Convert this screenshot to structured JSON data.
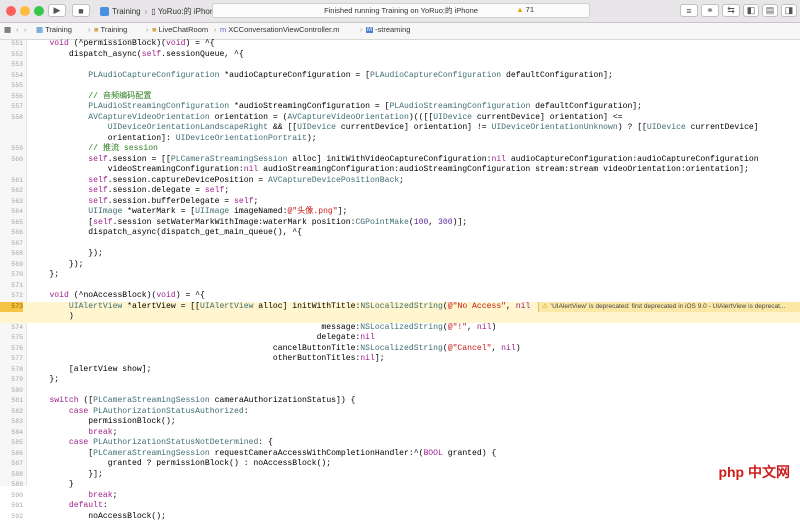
{
  "toolbar": {
    "scheme": "Training",
    "device": "YoRuo:的 iPhone",
    "status_text": "Finished running Training on YoRuo:的 iPhone",
    "warning_count": "71"
  },
  "pathbar": {
    "crumbs": [
      "Training",
      "Training",
      "LiveChatRoom",
      "XCConversationViewController.m",
      "-streaming"
    ]
  },
  "warning": {
    "message": "'UIAlertView' is deprecated: first deprecated in iOS 9.0 - UIAlertView is deprecat..."
  },
  "watermark": "php 中文网",
  "code_lines": [
    {
      "num": "551",
      "text": "    void (^permissionBlock)(void) = ^{"
    },
    {
      "num": "552",
      "text": "        dispatch_async(self.sessionQueue, ^{"
    },
    {
      "num": "553",
      "text": ""
    },
    {
      "num": "554",
      "text": "            PLAudioCaptureConfiguration *audioCaptureConfiguration = [PLAudioCaptureConfiguration defaultConfiguration];"
    },
    {
      "num": "555",
      "text": ""
    },
    {
      "num": "556",
      "text": "            // 音频编码配置"
    },
    {
      "num": "557",
      "text": "            PLAudioStreamingConfiguration *audioStreamingConfiguration = [PLAudioStreamingConfiguration defaultConfiguration];"
    },
    {
      "num": "558",
      "text": "            AVCaptureVideoOrientation orientation = (AVCaptureVideoOrientation)(([[UIDevice currentDevice] orientation] <="
    },
    {
      "num": "",
      "text": "                UIDeviceOrientationLandscapeRight && [[UIDevice currentDevice] orientation] != UIDeviceOrientationUnknown) ? [[UIDevice currentDevice]"
    },
    {
      "num": "",
      "text": "                orientation]: UIDeviceOrientationPortrait);"
    },
    {
      "num": "559",
      "text": "            // 推流 session"
    },
    {
      "num": "560",
      "text": "            self.session = [[PLCameraStreamingSession alloc] initWithVideoCaptureConfiguration:nil audioCaptureConfiguration:audioCaptureConfiguration"
    },
    {
      "num": "",
      "text": "                videoStreamingConfiguration:nil audioStreamingConfiguration:audioStreamingConfiguration stream:stream videoOrientation:orientation];"
    },
    {
      "num": "561",
      "text": "            self.session.captureDevicePosition = AVCaptureDevicePositionBack;"
    },
    {
      "num": "562",
      "text": "            self.session.delegate = self;"
    },
    {
      "num": "563",
      "text": "            self.session.bufferDelegate = self;"
    },
    {
      "num": "564",
      "text": "            UIImage *waterMark = [UIImage imageNamed:@\"头像.png\"];"
    },
    {
      "num": "565",
      "text": "            [self.session setWaterMarkWithImage:waterMark position:CGPointMake(100, 300)];"
    },
    {
      "num": "566",
      "text": "            dispatch_async(dispatch_get_main_queue(), ^{"
    },
    {
      "num": "567",
      "text": ""
    },
    {
      "num": "568",
      "text": "            });"
    },
    {
      "num": "569",
      "text": "        });"
    },
    {
      "num": "570",
      "text": "    };"
    },
    {
      "num": "571",
      "text": ""
    },
    {
      "num": "572",
      "text": "    void (^noAccessBlock)(void) = ^{"
    },
    {
      "num": "573",
      "text": "        UIAlertView *alertView = [[UIAlertView alloc] initWithTitle:NSLocalizedString(@\"No Access\", nil"
    },
    {
      "num": "",
      "text": "        )"
    },
    {
      "num": "574",
      "text": "                                                            message:NSLocalizedString(@\"!\", nil)"
    },
    {
      "num": "575",
      "text": "                                                           delegate:nil"
    },
    {
      "num": "576",
      "text": "                                                  cancelButtonTitle:NSLocalizedString(@\"Cancel\", nil)"
    },
    {
      "num": "577",
      "text": "                                                  otherButtonTitles:nil];"
    },
    {
      "num": "578",
      "text": "        [alertView show];"
    },
    {
      "num": "579",
      "text": "    };"
    },
    {
      "num": "580",
      "text": ""
    },
    {
      "num": "581",
      "text": "    switch ([PLCameraStreamingSession cameraAuthorizationStatus]) {"
    },
    {
      "num": "582",
      "text": "        case PLAuthorizationStatusAuthorized:"
    },
    {
      "num": "583",
      "text": "            permissionBlock();"
    },
    {
      "num": "584",
      "text": "            break;"
    },
    {
      "num": "585",
      "text": "        case PLAuthorizationStatusNotDetermined: {"
    },
    {
      "num": "586",
      "text": "            [PLCameraStreamingSession requestCameraAccessWithCompletionHandler:^(BOOL granted) {"
    },
    {
      "num": "587",
      "text": "                granted ? permissionBlock() : noAccessBlock();"
    },
    {
      "num": "588",
      "text": "            }];"
    },
    {
      "num": "589",
      "text": "        }"
    },
    {
      "num": "590",
      "text": "            break;"
    },
    {
      "num": "591",
      "text": "        default:"
    },
    {
      "num": "592",
      "text": "            noAccessBlock();"
    }
  ]
}
